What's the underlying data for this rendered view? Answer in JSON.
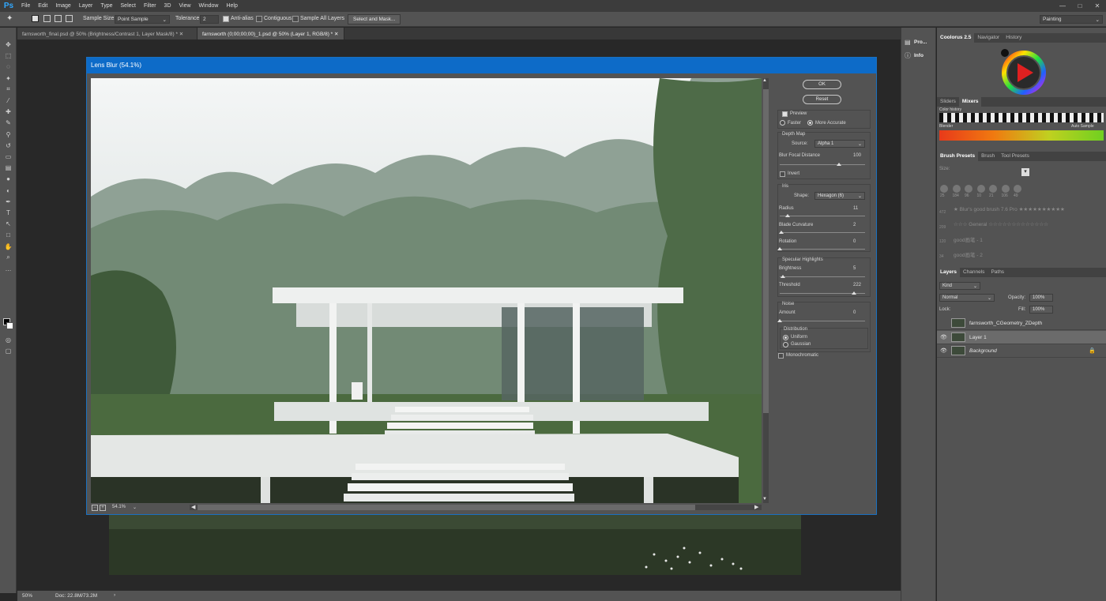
{
  "app": {
    "logo": "Ps"
  },
  "menu": [
    "File",
    "Edit",
    "Image",
    "Layer",
    "Type",
    "Select",
    "Filter",
    "3D",
    "View",
    "Window",
    "Help"
  ],
  "window_controls": {
    "minimize": "—",
    "maximize": "□",
    "close": "✕"
  },
  "options": {
    "sample_size_label": "Sample Size:",
    "sample_size_value": "Point Sample",
    "tolerance_label": "Tolerance:",
    "tolerance_value": "2",
    "anti_alias": "Anti-alias",
    "contiguous": "Contiguous",
    "sample_all_layers": "Sample All Layers",
    "select_and_mask": "Select and Mask...",
    "workspace": "Painting"
  },
  "doc_tabs": [
    "farnsworth_final.psd @ 50% (Brightness/Contrast 1, Layer Mask/8) * ✕",
    "farnsworth (0;00;00;00)_1.psd @ 50% (Layer 1, RGB/8) * ✕"
  ],
  "status": {
    "zoom": "50%",
    "doc": "Doc: 22.8M/73.2M",
    "arrow": "›"
  },
  "mini_panels": [
    {
      "label": "Pro..."
    },
    {
      "label": "Info"
    }
  ],
  "dialog": {
    "title": "Lens Blur (54.1%)",
    "ok": "OK",
    "reset": "Reset",
    "preview": "Preview",
    "faster": "Faster",
    "more_accurate": "More Accurate",
    "depth_map": "Depth Map",
    "source_label": "Source:",
    "source_value": "Alpha 1",
    "blur_focal_label": "Blur Focal Distance",
    "blur_focal_value": "100",
    "invert": "Invert",
    "iris": "Iris",
    "shape_label": "Shape:",
    "shape_value": "Hexagon (6)",
    "radius_label": "Radius",
    "radius_value": "11",
    "blade_label": "Blade Curvature",
    "blade_value": "2",
    "rotation_label": "Rotation",
    "rotation_value": "0",
    "specular": "Specular Highlights",
    "brightness_label": "Brightness",
    "brightness_value": "5",
    "threshold_label": "Threshold",
    "threshold_value": "222",
    "noise": "Noise",
    "amount_label": "Amount",
    "amount_value": "0",
    "distribution": "Distribution",
    "uniform": "Uniform",
    "gaussian": "Gaussian",
    "monochromatic": "Monochromatic",
    "zoom": "54.1%"
  },
  "color_panel": {
    "tabs": [
      "Coolorus 2.5",
      "Navigator",
      "History"
    ]
  },
  "sliders_panel": {
    "tabs": [
      "Sliders",
      "Mixers"
    ],
    "color_history": "Color history",
    "blender": "Blender",
    "auto_sample": "Auto Sample"
  },
  "brush_panel": {
    "tabs": [
      "Brush Presets",
      "Brush",
      "Tool Presets"
    ],
    "size_label": "Size:",
    "sizes": [
      "25",
      "184",
      "96",
      "10",
      "21",
      "106",
      "49"
    ],
    "presets": [
      {
        "num": "472",
        "name": "★ Blur's good brush 7.6 Pro ★★★★★★★★★★"
      },
      {
        "num": "209",
        "name": "☆☆☆ General ☆☆☆☆☆☆☆☆☆☆☆☆☆"
      },
      {
        "num": "120",
        "name": "good画笔 - 1"
      },
      {
        "num": "34",
        "name": "good画笔 - 2"
      }
    ]
  },
  "layers_panel": {
    "tabs": [
      "Layers",
      "Channels",
      "Paths"
    ],
    "kind": "Kind",
    "blend": "Normal",
    "opacity_label": "Opacity:",
    "opacity": "100%",
    "lock_label": "Lock:",
    "fill_label": "Fill:",
    "fill": "100%",
    "layers": [
      {
        "name": "farnsworth_CGeometry_ZDepth",
        "visible": false,
        "selected": false
      },
      {
        "name": "Layer 1",
        "visible": true,
        "selected": true
      },
      {
        "name": "Background",
        "visible": true,
        "selected": false
      }
    ]
  },
  "colors": {
    "accent": "#0d6bc8",
    "panel": "#535353",
    "dark": "#282828"
  }
}
